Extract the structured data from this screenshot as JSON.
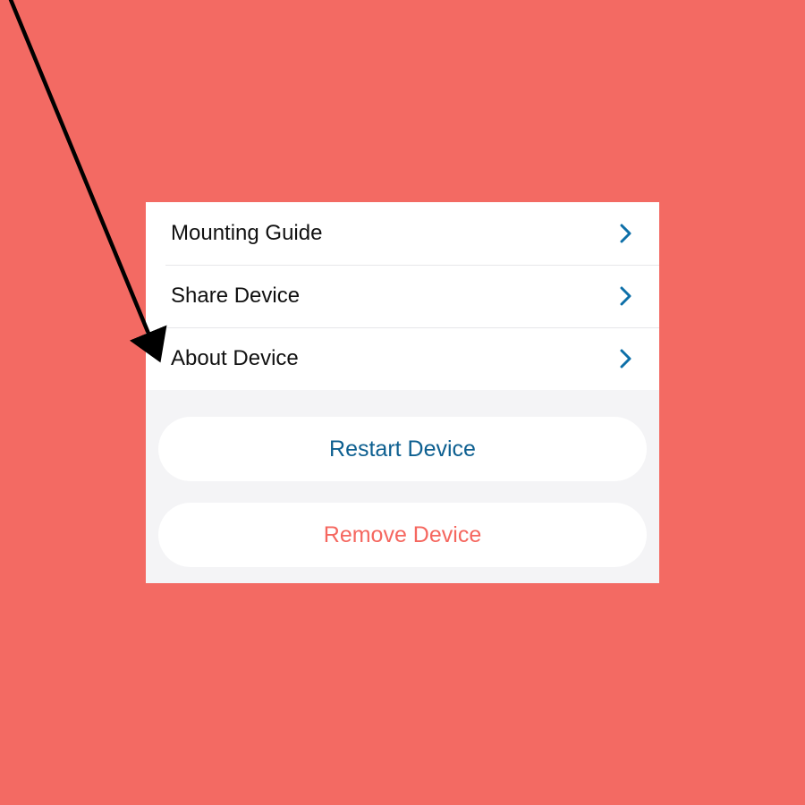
{
  "menu": {
    "items": [
      {
        "label": "Mounting Guide"
      },
      {
        "label": "Share Device"
      },
      {
        "label": "About Device"
      }
    ]
  },
  "actions": {
    "restart_label": "Restart Device",
    "remove_label": "Remove Device"
  },
  "colors": {
    "background": "#f36a63",
    "chevron": "#0d6fa8",
    "restart_text": "#0d5f90",
    "remove_text": "#f5675f"
  },
  "annotation": {
    "arrow_points_to": "about-device"
  }
}
